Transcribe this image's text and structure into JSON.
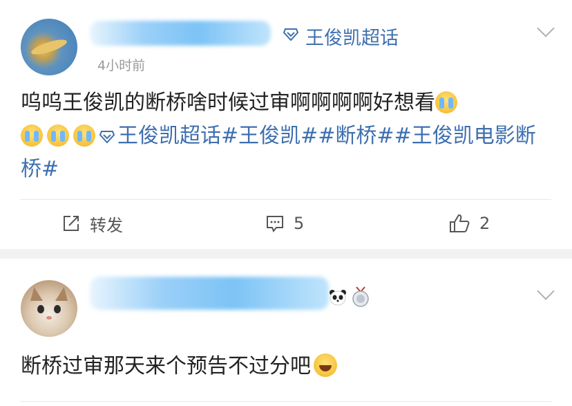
{
  "post1": {
    "timestamp": "4小时前",
    "super_topic": "王俊凯超话",
    "content_text": "呜呜王俊凯的断桥啥时候过审啊啊啊啊好想看",
    "topics": [
      "王俊凯超话",
      "#王俊凯#",
      "#断桥#",
      "#王俊凯电影断桥#"
    ],
    "actions": {
      "repost_label": "转发",
      "comment_count": "5",
      "like_count": "2"
    }
  },
  "post2": {
    "content_text": "断桥过审那天来个预告不过分吧"
  },
  "icons": [
    "super-topic-diamond-icon",
    "crying-emoji-icon",
    "repost-icon",
    "comment-icon",
    "like-icon",
    "chevron-down-icon",
    "panda-icon",
    "badge-icon",
    "grin-emoji-icon"
  ],
  "colors": {
    "link": "#3d6faf",
    "text": "#222222",
    "meta": "#9a9a9a",
    "separator": "#f2f2f2"
  }
}
